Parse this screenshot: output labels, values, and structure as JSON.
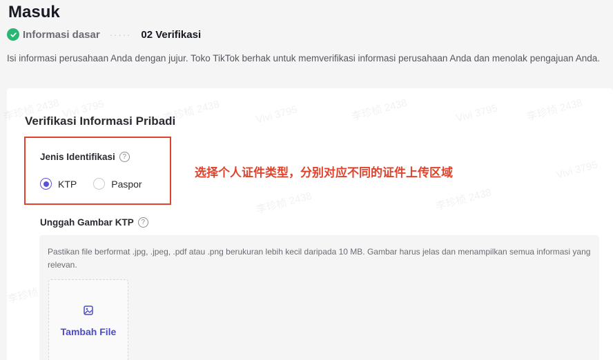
{
  "header": {
    "title": "Masuk",
    "steps": [
      {
        "label": "Informasi dasar",
        "status": "done"
      },
      {
        "label": "02 Verifikasi",
        "status": "active"
      }
    ],
    "step_separator": "·····",
    "intro": "Isi informasi perusahaan Anda dengan jujur. Toko TikTok berhak untuk memverifikasi informasi perusahaan Anda dan menolak pengajuan Anda."
  },
  "form": {
    "section_title": "Verifikasi Informasi Pribadi",
    "id_type": {
      "label": "Jenis Identifikasi",
      "help_glyph": "?",
      "options": [
        {
          "label": "KTP",
          "selected": true
        },
        {
          "label": "Paspor",
          "selected": false
        }
      ]
    },
    "annotation": "选择个人证件类型，分别对应不同的证件上传区域",
    "upload": {
      "label": "Unggah Gambar KTP",
      "help_glyph": "?",
      "hint": "Pastikan file berformat .jpg, .jpeg, .pdf atau .png berukuran lebih kecil daripada 10 MB. Gambar harus jelas dan menampilkan semua informasi yang relevan.",
      "button_label": "Tambah File"
    }
  },
  "watermarks": [
    "李珍桢 2438",
    "Vivi 3795"
  ],
  "colors": {
    "accent": "#5b53d6",
    "success": "#2bb673",
    "annotation": "#e0432c",
    "link": "#4b4bc7"
  }
}
